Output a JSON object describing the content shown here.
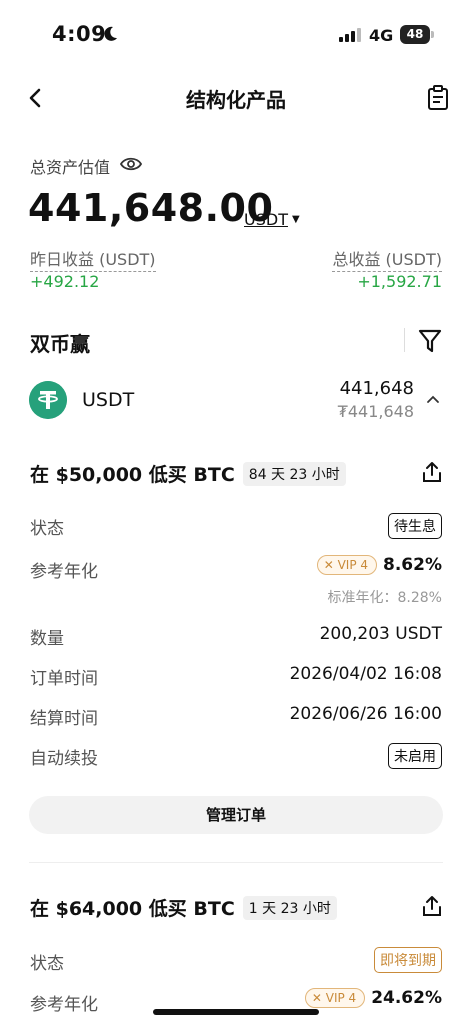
{
  "status_bar": {
    "time": "4:09",
    "network": "4G",
    "battery": "48"
  },
  "nav": {
    "title": "结构化产品"
  },
  "summary": {
    "total_label": "总资产估值",
    "total_value": "441,648.00",
    "currency": "USDT",
    "yesterday_label": "昨日收益 (USDT)",
    "yesterday_value": "+492.12",
    "total_pnl_label": "总收益 (USDT)",
    "total_pnl_value": "+1,592.71",
    "positive_color": "#27a644"
  },
  "section": {
    "title": "双币赢"
  },
  "coin": {
    "name": "USDT",
    "amount": "441,648",
    "amount_fiat": "₮441,648",
    "logo_color": "#26a17b"
  },
  "orders": [
    {
      "title": "在 $50,000 低买 BTC",
      "term": "84 天 23 小时",
      "status_label": "状态",
      "status": "待生息",
      "apr_label": "参考年化",
      "vip": "VIP 4",
      "apr": "8.62%",
      "std_apr": "标准年化：8.28%",
      "qty_label": "数量",
      "qty": "200,203 USDT",
      "order_time_label": "订单时间",
      "order_time": "2026/04/02 16:08",
      "settle_time_label": "结算时间",
      "settle_time": "2026/06/26 16:00",
      "auto_label": "自动续投",
      "auto": "未启用",
      "manage": "管理订单"
    },
    {
      "title": "在 $64,000 低买 BTC",
      "term": "1 天 23 小时",
      "status_label": "状态",
      "status": "即将到期",
      "apr_label": "参考年化",
      "vip": "VIP 4",
      "apr": "24.62%"
    }
  ]
}
